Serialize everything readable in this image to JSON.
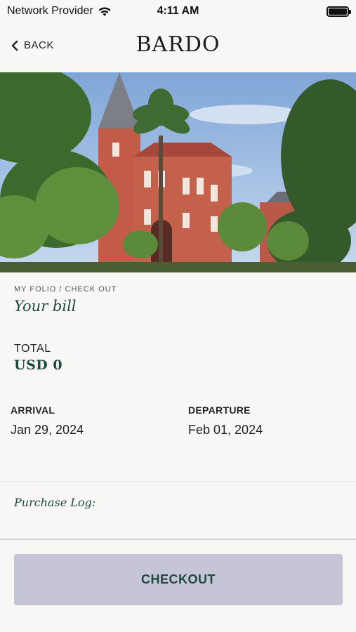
{
  "status_bar": {
    "carrier": "Network Provider",
    "time": "4:11 AM"
  },
  "nav": {
    "back_label": "BACK",
    "logo": "BARDO"
  },
  "hero": {
    "image_icon": "building-photo"
  },
  "bill": {
    "breadcrumb": "MY FOLIO / CHECK OUT",
    "title": "Your bill",
    "total_label": "TOTAL",
    "total_value": "USD 0",
    "arrival_label": "ARRIVAL",
    "arrival_value": "Jan 29, 2024",
    "departure_label": "DEPARTURE",
    "departure_value": "Feb 01, 2024",
    "purchase_log_label": "Purchase Log:"
  },
  "footer": {
    "checkout_label": "CHECKOUT"
  },
  "colors": {
    "accent_green": "#1f4a3d",
    "button_bg": "#c6c5d8",
    "page_bg": "#f8f7f5"
  }
}
